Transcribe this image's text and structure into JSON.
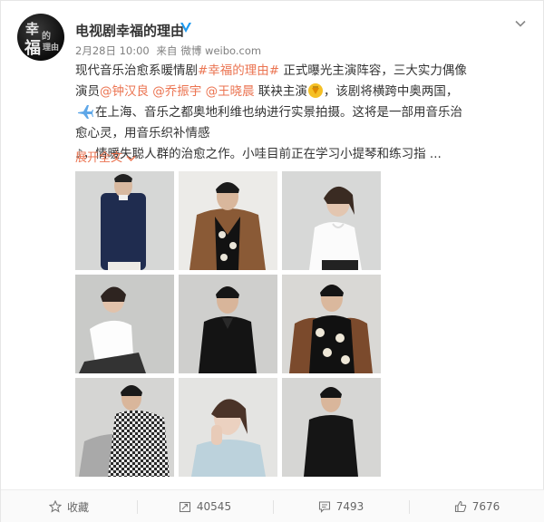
{
  "post": {
    "username": "电视剧幸福的理由",
    "avatar_glyphs": [
      "幸",
      "福",
      "的",
      "理由"
    ],
    "meta": {
      "date": "2月28日 10:00",
      "source_prefix": "来自",
      "source": "微博 weibo.com"
    },
    "text": {
      "p1": "现代音乐治愈系暖情剧",
      "hashtag": "#幸福的理由#",
      "p2": " 正式曝光主演阵容，三大实力偶像演员",
      "mention1": "@钟汉良",
      "sep1": " ",
      "mention2": "@乔振宇",
      "sep2": " ",
      "mention3": "@王晓晨",
      "p3": " 联袂主演",
      "p4": "，该剧将横跨中奥两国，",
      "p5": "在上海、音乐之都奥地利维也纳进行实景拍摄。这将是一部用音乐治愈心灵，用音乐织补情感",
      "p6": "，情暖失聪人群的治愈之作。小哇目前正在学习小提琴和练习指 ...",
      "music_note": "♪"
    },
    "expand_label": "展开全文",
    "photos": [
      {
        "desc": "man in navy sweater"
      },
      {
        "desc": "man in brown leather jacket"
      },
      {
        "desc": "woman in white shirt"
      },
      {
        "desc": "woman in white shirt seated"
      },
      {
        "desc": "man in black shirt"
      },
      {
        "desc": "man in printed black shirt"
      },
      {
        "desc": "man in checked sweater"
      },
      {
        "desc": "woman in light blue top"
      },
      {
        "desc": "man in black shirt standing"
      }
    ]
  },
  "actions": {
    "favorite_label": "收藏",
    "repost_count": "40545",
    "comment_count": "7493",
    "like_count": "7676"
  },
  "colors": {
    "accent": "#eb7350",
    "verified": "#1e9bf0"
  }
}
